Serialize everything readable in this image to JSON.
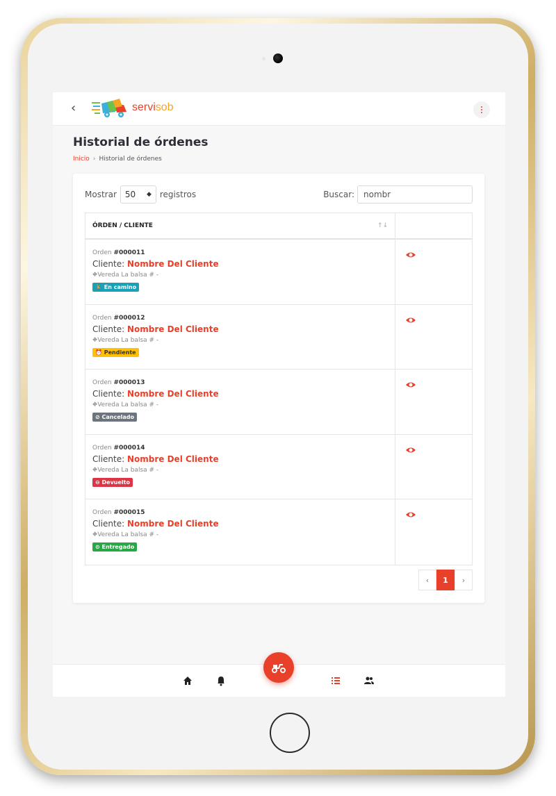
{
  "app": {
    "brand_part1": "servi",
    "brand_part2": "sob",
    "back_label": "‹"
  },
  "page": {
    "title": "Historial de órdenes",
    "breadcrumb_home": "Inicio",
    "breadcrumb_sep": "›",
    "breadcrumb_current": "Historial de órdenes"
  },
  "table_controls": {
    "show_label": "Mostrar",
    "show_value": "50",
    "records_label": "registros",
    "search_label": "Buscar:",
    "search_value": "nombr"
  },
  "table": {
    "header": "ÓRDEN / CLIENTE",
    "sort_icon": "↑↓",
    "rows": [
      {
        "order_prefix": "Orden ",
        "order_number": "#000011",
        "client_prefix": "Cliente: ",
        "client_name": "Nombre Del Cliente",
        "address": "Vereda La balsa # -",
        "status": "En camino",
        "status_color": "#17a2b8",
        "status_icon": "🚴"
      },
      {
        "order_prefix": "Orden ",
        "order_number": "#000012",
        "client_prefix": "Cliente: ",
        "client_name": "Nombre Del Cliente",
        "address": "Vereda La balsa # -",
        "status": "Pendiente",
        "status_color": "#ffc107",
        "status_icon": "⏰"
      },
      {
        "order_prefix": "Orden ",
        "order_number": "#000013",
        "client_prefix": "Cliente: ",
        "client_name": "Nombre Del Cliente",
        "address": "Vereda La balsa # -",
        "status": "Cancelado",
        "status_color": "#6c757d",
        "status_icon": "⊘"
      },
      {
        "order_prefix": "Orden ",
        "order_number": "#000014",
        "client_prefix": "Cliente: ",
        "client_name": "Nombre Del Cliente",
        "address": "Vereda La balsa # -",
        "status": "Devuelto",
        "status_color": "#dc3545",
        "status_icon": "⊖"
      },
      {
        "order_prefix": "Orden ",
        "order_number": "#000015",
        "client_prefix": "Cliente: ",
        "client_name": "Nombre Del Cliente",
        "address": "Vereda La balsa # -",
        "status": "Entregado",
        "status_color": "#28a745",
        "status_icon": "⊙"
      }
    ]
  },
  "pagination": {
    "prev": "‹",
    "current": "1",
    "next": "›"
  },
  "colors": {
    "accent": "#e8402a",
    "brand_secondary": "#f5a623"
  },
  "icons": [
    "back-icon",
    "logo-truck-icon",
    "kebab-menu-icon",
    "eye-icon",
    "home-icon",
    "bell-icon",
    "scooter-icon",
    "list-icon",
    "users-icon",
    "sort-icon"
  ]
}
